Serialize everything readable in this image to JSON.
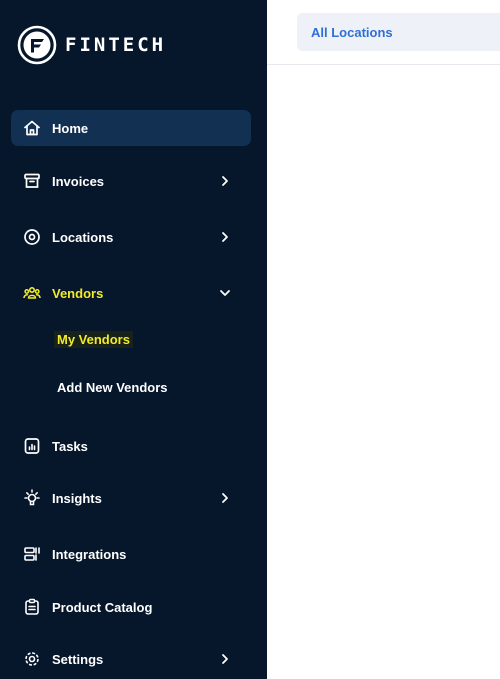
{
  "brand": {
    "name": "FINTECH"
  },
  "sidebar": {
    "items": [
      {
        "label": "Home",
        "icon": "home-icon"
      },
      {
        "label": "Invoices",
        "icon": "archive-icon"
      },
      {
        "label": "Locations",
        "icon": "location-pin-icon"
      },
      {
        "label": "Vendors",
        "icon": "users-icon"
      },
      {
        "label": "Tasks",
        "icon": "chart-file-icon"
      },
      {
        "label": "Insights",
        "icon": "lightbulb-icon"
      },
      {
        "label": "Integrations",
        "icon": "integrations-icon"
      },
      {
        "label": "Product Catalog",
        "icon": "clipboard-icon"
      },
      {
        "label": "Settings",
        "icon": "gear-icon"
      }
    ],
    "vendors_sub": [
      "My Vendors",
      "Add New Vendors"
    ],
    "active": "Home",
    "expanded": "Vendors",
    "selected_sub": "My Vendors"
  },
  "topbar": {
    "location_select": "All Locations"
  },
  "colors": {
    "sidebar_bg": "#06162b",
    "active_bg": "#123052",
    "highlight": "#f2ea2b",
    "link": "#2f6fd6"
  }
}
